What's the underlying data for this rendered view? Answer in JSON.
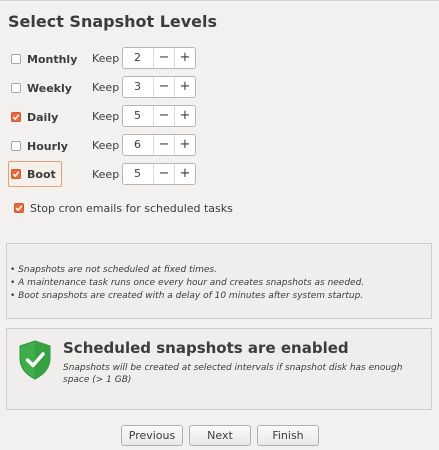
{
  "page": {
    "title": "Select Snapshot Levels"
  },
  "levels": [
    {
      "label": "Monthly",
      "checked": false,
      "keep_label": "Keep",
      "value": "2",
      "minus": "−",
      "plus": "+"
    },
    {
      "label": "Weekly",
      "checked": false,
      "keep_label": "Keep",
      "value": "3",
      "minus": "−",
      "plus": "+"
    },
    {
      "label": "Daily",
      "checked": true,
      "keep_label": "Keep",
      "value": "5",
      "minus": "−",
      "plus": "+"
    },
    {
      "label": "Hourly",
      "checked": false,
      "keep_label": "Keep",
      "value": "6",
      "minus": "−",
      "plus": "+"
    },
    {
      "label": "Boot",
      "checked": true,
      "keep_label": "Keep",
      "value": "5",
      "minus": "−",
      "plus": "+"
    }
  ],
  "cron": {
    "label": "Stop cron emails for scheduled tasks",
    "checked": true
  },
  "info": {
    "lines": [
      "• Snapshots are not scheduled at fixed times.",
      "• A maintenance task runs once every hour and creates snapshots as needed.",
      "• Boot snapshots are created with a delay of 10 minutes after system startup."
    ]
  },
  "status": {
    "icon": "shield-check-icon",
    "title": "Scheduled snapshots are enabled",
    "description": "Snapshots will be created at selected intervals if snapshot disk has enough space (> 1 GB)",
    "color": "#4caf50"
  },
  "buttons": {
    "previous": "Previous",
    "next": "Next",
    "finish": "Finish"
  },
  "colors": {
    "accent": "#e96a3a",
    "background": "#f2f1f0"
  }
}
